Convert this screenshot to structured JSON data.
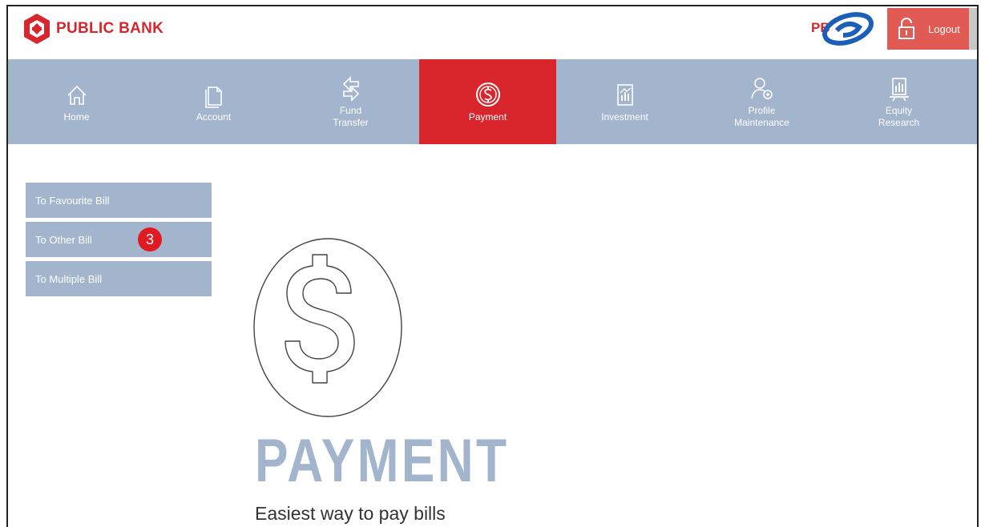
{
  "header": {
    "brand_name": "PUBLIC BANK",
    "pbe_logo_text": "PB",
    "logout_label": "Logout"
  },
  "nav": {
    "items": [
      {
        "label": "Home",
        "icon": "home-icon"
      },
      {
        "label": "Account",
        "icon": "document-icon"
      },
      {
        "label": "Fund\nTransfer",
        "icon": "transfer-icon"
      },
      {
        "label": "Payment",
        "icon": "dollar-icon",
        "active": true
      },
      {
        "label": "Investment",
        "icon": "chart-doc-icon"
      },
      {
        "label": "Profile\nMaintenance",
        "icon": "profile-gear-icon"
      },
      {
        "label": "Equity\nResearch",
        "icon": "research-icon"
      }
    ]
  },
  "side_menu": {
    "items": [
      "To Favourite Bill",
      "To Other Bill",
      "To Multiple Bill"
    ],
    "step_badge": "3"
  },
  "hero": {
    "title": "PAYMENT",
    "subtitle": "Easiest way to pay bills"
  },
  "colors": {
    "brand_red": "#d7262c",
    "nav_bg": "#a3b4cd",
    "active_bg": "#d9262d",
    "logout_bg": "#e15a53"
  }
}
